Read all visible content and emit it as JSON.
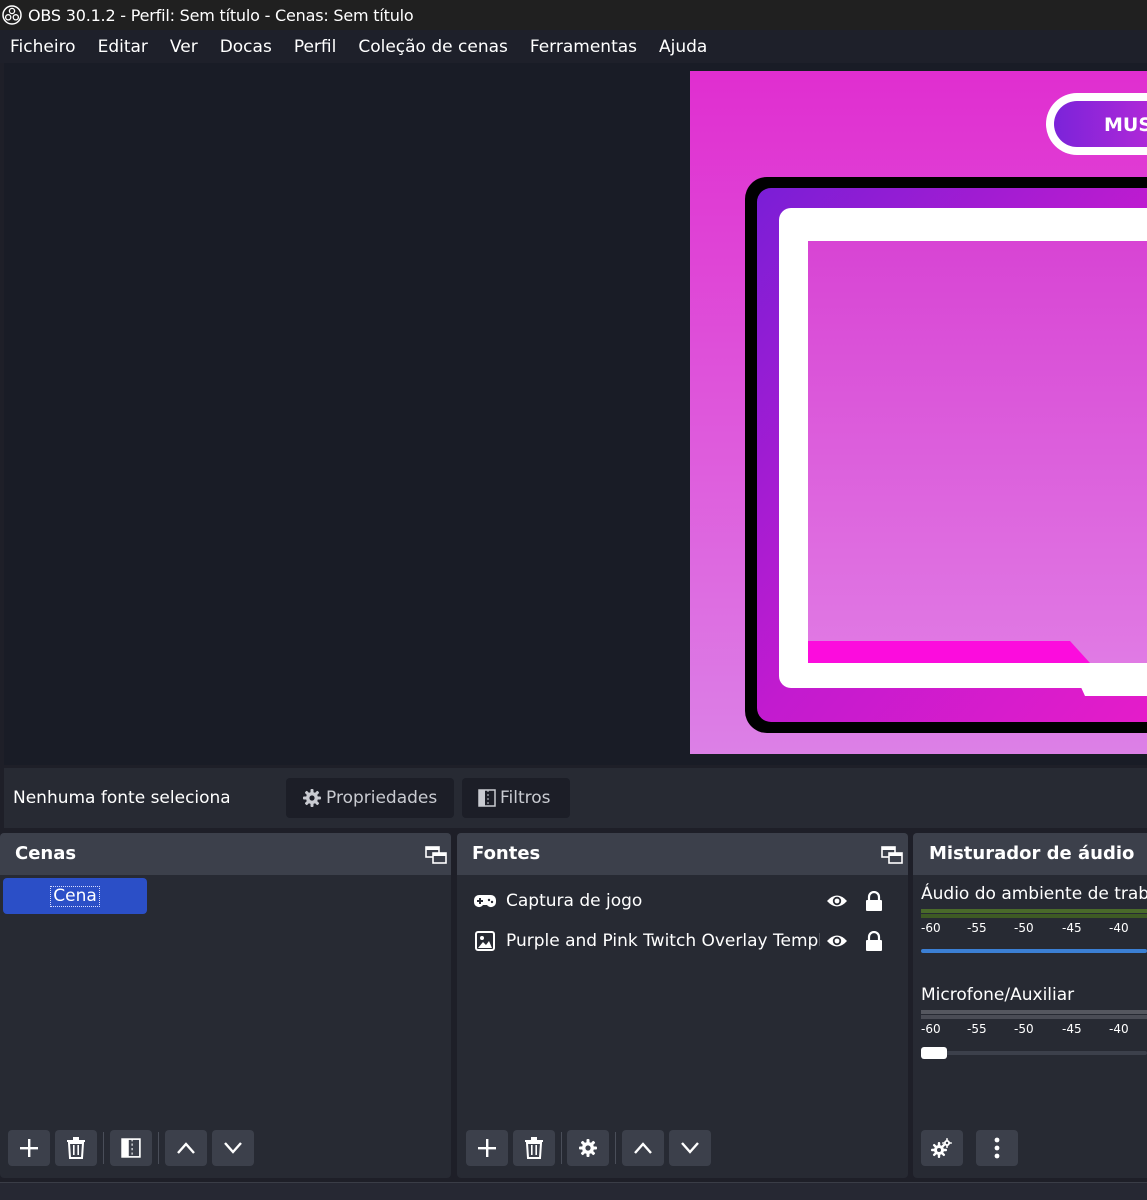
{
  "window": {
    "title": "OBS 30.1.2 - Perfil: Sem título - Cenas: Sem título"
  },
  "menu": [
    "Ficheiro",
    "Editar",
    "Ver",
    "Docas",
    "Perfil",
    "Coleção de cenas",
    "Ferramentas",
    "Ajuda"
  ],
  "preview": {
    "overlay_text": "MUS"
  },
  "context": {
    "no_source": "Nenhuma fonte selecionada",
    "properties_label": "Propriedades",
    "filters_label": "Filtros"
  },
  "scenes": {
    "title": "Cenas",
    "items": [
      "Cena"
    ]
  },
  "sources": {
    "title": "Fontes",
    "items": [
      {
        "label": "Captura de jogo",
        "icon": "gamepad-icon"
      },
      {
        "label": "Purple and Pink Twitch Overlay Template",
        "icon": "image-icon"
      }
    ]
  },
  "mixer": {
    "title": "Misturador de áudio",
    "channels": [
      {
        "label": "Áudio do ambiente de trabalho",
        "ticks": [
          "-60",
          "-55",
          "-50",
          "-45",
          "-40"
        ],
        "volume_slider": 1.0,
        "track_color": "#3b7fd4"
      },
      {
        "label": "Microfone/Auxiliar",
        "ticks": [
          "-60",
          "-55",
          "-50",
          "-45",
          "-40"
        ],
        "volume_slider": 0.0,
        "track_color": "#3c404b"
      }
    ]
  },
  "colors": {
    "selection": "#2b4fc7",
    "dock_header": "#3c404b",
    "panel": "#272a33"
  }
}
